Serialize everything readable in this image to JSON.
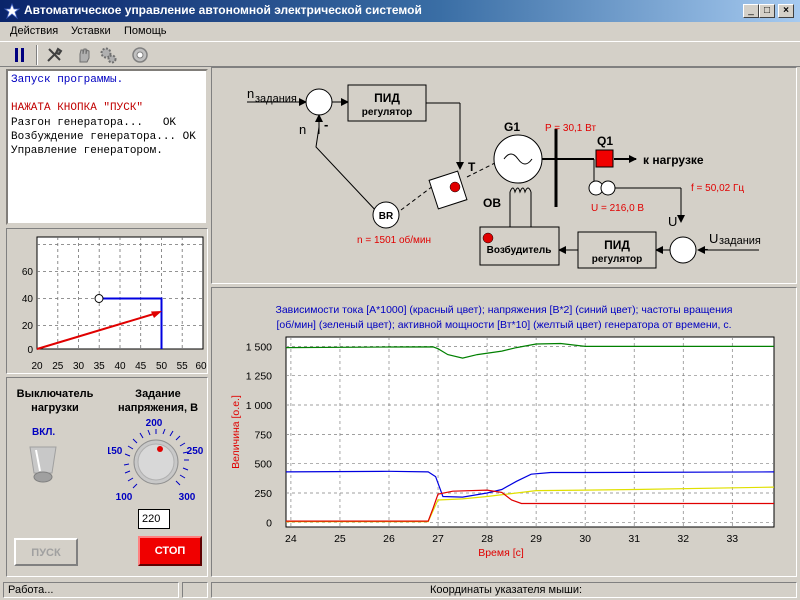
{
  "window": {
    "title": "Автоматическое управление автономной электрической системой"
  },
  "menu": [
    "Действия",
    "Уставки",
    "Помощь"
  ],
  "log": [
    {
      "text": "Запуск программы.",
      "color": "#0000c0"
    },
    {
      "text": "",
      "color": "#000000"
    },
    {
      "text": "НАЖАТА КНОПКА \"ПУСК\"",
      "color": "#c00000"
    },
    {
      "text": "Разгон генератора...   OK",
      "color": "#000000"
    },
    {
      "text": "Возбуждение генератора... OK",
      "color": "#000000"
    },
    {
      "text": "Управление генератором.",
      "color": "#000000"
    }
  ],
  "phase_plot": {
    "x_ticks": [
      "20",
      "25",
      "30",
      "35",
      "40",
      "45",
      "50",
      "55",
      "60"
    ],
    "y_ticks": [
      "0",
      "20",
      "40",
      "60"
    ]
  },
  "controls": {
    "switch_label_1": "Выключатель",
    "switch_label_2": "нагрузки",
    "switch_state": "ВКЛ.",
    "voltage_label_1": "Задание",
    "voltage_label_2": "напряжения, В",
    "knob_ticks": [
      "100",
      "150",
      "200",
      "250",
      "300"
    ],
    "voltage_value": "220",
    "start_button": "ПУСК",
    "stop_button": "СТОП"
  },
  "schema": {
    "n_set": "n",
    "n_set_sub": "задания",
    "n_fb": "n",
    "minus": "-",
    "pid_title": "ПИД",
    "pid_sub": "регулятор",
    "turbine": "T",
    "generator": "G1",
    "power": "P = 30,1 Вт",
    "breaker": "Q1",
    "load": "к нагрузке",
    "freq": "f = 50,02 Гц",
    "voltage": "U = 216,0 В",
    "u_fb": "U",
    "u_set": "U",
    "u_set_sub": "задания",
    "ob": "ОВ",
    "br": "BR",
    "speed": "n = 1501 об/мин",
    "exciter": "Возбудитель"
  },
  "chart_data": {
    "type": "line",
    "title": "Зависимости тока [А*1000] (красный цвет); напряжения [В*2] (синий цвет); частоты вращения [об/мин] (зеленый цвет); активной мощности [Вт*10] (желтый цвет) генератора от времени, с.",
    "title_line1": "Зависимости тока [А*1000] (красный цвет); напряжения  [В*2] (синий цвет); частоты вращения",
    "title_line2": "[об/мин] (зеленый цвет);  активной мощности [Вт*10] (желтый цвет) генератора от времени, с.",
    "xlabel": "Время [с]",
    "ylabel": "Величина [о.е.]",
    "xlim": [
      23.9,
      33.85
    ],
    "ylim": [
      -40,
      1580
    ],
    "x_ticks": [
      24,
      25,
      26,
      27,
      28,
      29,
      30,
      31,
      32,
      33
    ],
    "y_ticks": [
      0,
      250,
      500,
      750,
      1000,
      1250,
      1500
    ],
    "y_tick_labels": [
      "0",
      "250",
      "500",
      "750",
      "1 000",
      "1 250",
      "1 500"
    ],
    "grid": true,
    "series": [
      {
        "color": "#008000",
        "x": [
          23.9,
          26.0,
          26.9,
          27.0,
          27.2,
          27.5,
          27.8,
          28.3,
          28.6,
          29.0,
          29.5,
          30.0,
          33.85
        ],
        "y": [
          1490,
          1495,
          1496,
          1480,
          1430,
          1400,
          1430,
          1460,
          1490,
          1520,
          1525,
          1500,
          1500
        ]
      },
      {
        "color": "#0000e0",
        "x": [
          23.9,
          26.0,
          26.8,
          26.95,
          27.1,
          27.5,
          28.0,
          28.3,
          28.6,
          28.9,
          29.3,
          30.0,
          33.85
        ],
        "y": [
          430,
          435,
          430,
          390,
          220,
          215,
          250,
          280,
          350,
          410,
          425,
          425,
          430
        ]
      },
      {
        "color": "#e0e000",
        "x": [
          23.9,
          26.8,
          26.9,
          27.0,
          27.5,
          28.0,
          28.6,
          29.0,
          30.0,
          31.0,
          33.85
        ],
        "y": [
          5,
          5,
          100,
          190,
          200,
          220,
          250,
          270,
          275,
          280,
          300
        ]
      },
      {
        "color": "#e00000",
        "x": [
          23.9,
          26.8,
          26.9,
          27.0,
          27.3,
          28.0,
          28.3,
          28.5,
          28.7,
          29.5,
          33.85
        ],
        "y": [
          10,
          10,
          120,
          240,
          265,
          275,
          255,
          190,
          160,
          160,
          160
        ]
      }
    ]
  },
  "status": {
    "left": "Работа...",
    "right": "Координаты указателя мыши:"
  }
}
